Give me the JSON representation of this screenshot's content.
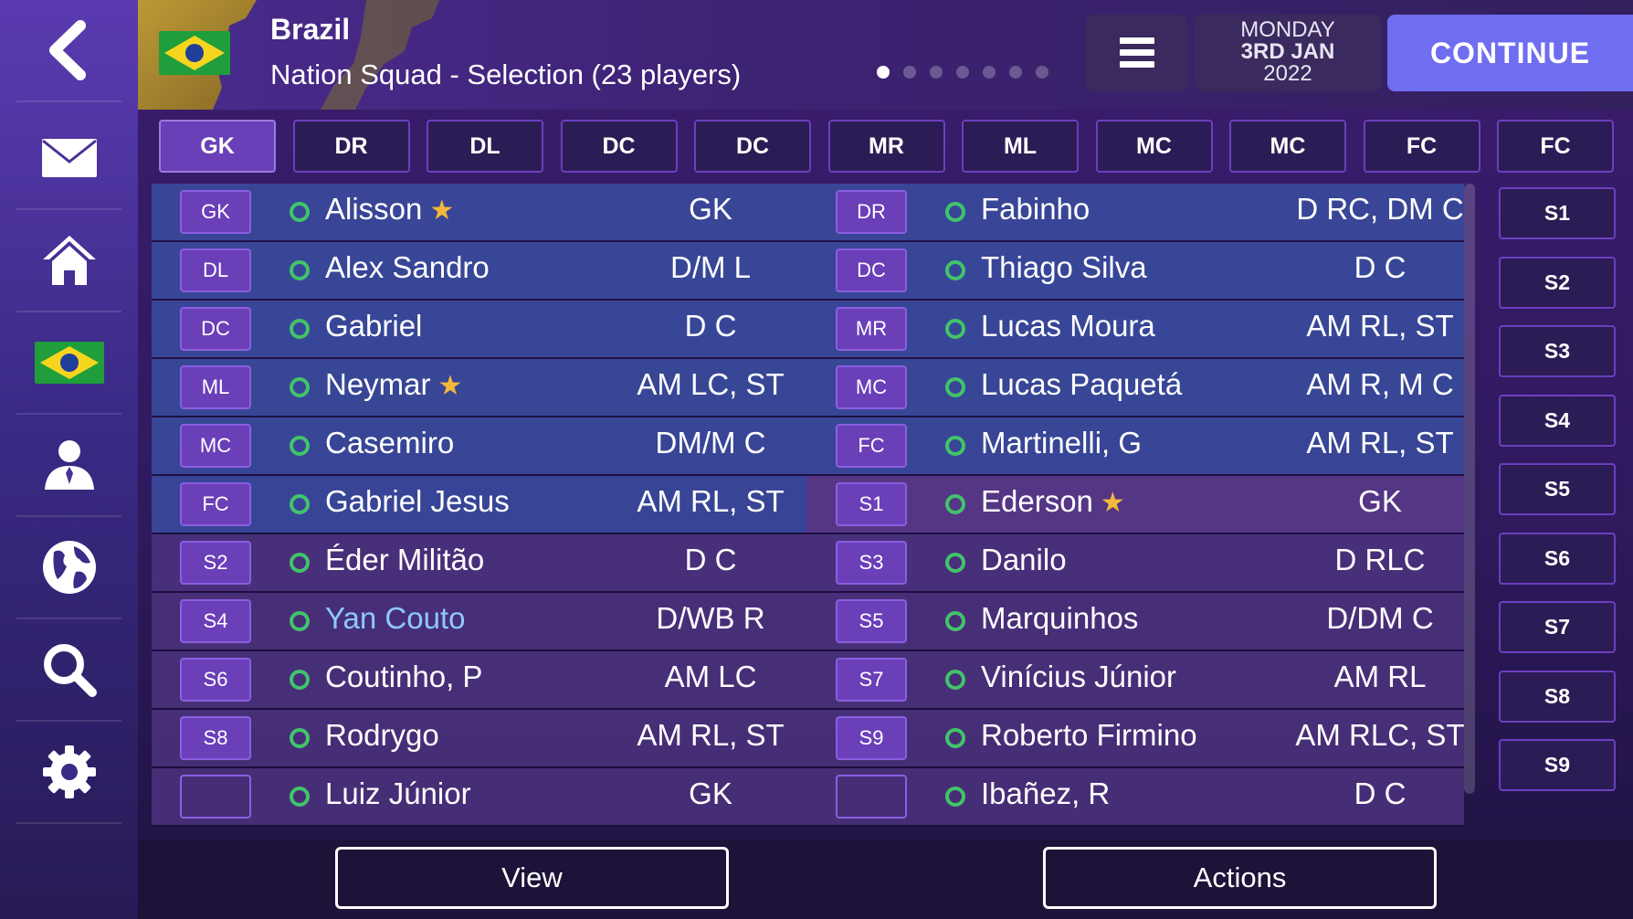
{
  "sidebar": {
    "items": [
      {
        "icon": "back-arrow-icon"
      },
      {
        "icon": "envelope-icon"
      },
      {
        "icon": "home-icon"
      },
      {
        "icon": "brazil-flag-icon"
      },
      {
        "icon": "manager-person-icon"
      },
      {
        "icon": "globe-icon"
      },
      {
        "icon": "search-icon"
      },
      {
        "icon": "gear-icon"
      }
    ]
  },
  "header": {
    "nation": "Brazil",
    "subtitle": "Nation Squad - Selection (23 players)",
    "page_count": 7,
    "current_page": 1,
    "date_day": "MONDAY",
    "date_date": "3RD JAN",
    "date_year": "2022",
    "continue_label": "CONTINUE"
  },
  "position_tabs": [
    "GK",
    "DR",
    "DL",
    "DC",
    "DC",
    "MR",
    "ML",
    "MC",
    "MC",
    "FC",
    "FC"
  ],
  "active_tab": 0,
  "players": [
    {
      "left": {
        "slot": "GK",
        "name": "Alisson",
        "star": true,
        "pos": "GK"
      },
      "right": {
        "slot": "DR",
        "name": "Fabinho",
        "star": false,
        "pos": "D RC, DM C"
      }
    },
    {
      "left": {
        "slot": "DL",
        "name": "Alex Sandro",
        "star": false,
        "pos": "D/M L"
      },
      "right": {
        "slot": "DC",
        "name": "Thiago Silva",
        "star": false,
        "pos": "D C"
      }
    },
    {
      "left": {
        "slot": "DC",
        "name": "Gabriel",
        "star": false,
        "pos": "D C"
      },
      "right": {
        "slot": "MR",
        "name": "Lucas Moura",
        "star": false,
        "pos": "AM RL, ST"
      }
    },
    {
      "left": {
        "slot": "ML",
        "name": "Neymar",
        "star": true,
        "pos": "AM LC, ST"
      },
      "right": {
        "slot": "MC",
        "name": "Lucas Paquetá",
        "star": false,
        "pos": "AM R, M C"
      }
    },
    {
      "left": {
        "slot": "MC",
        "name": "Casemiro",
        "star": false,
        "pos": "DM/M C"
      },
      "right": {
        "slot": "FC",
        "name": "Martinelli, G",
        "star": false,
        "pos": "AM RL, ST"
      }
    },
    {
      "left": {
        "slot": "FC",
        "name": "Gabriel Jesus",
        "star": false,
        "pos": "AM RL, ST"
      },
      "right": {
        "slot": "S1",
        "name": "Ederson",
        "star": true,
        "pos": "GK"
      }
    },
    {
      "left": {
        "slot": "S2",
        "name": "Éder Militão",
        "star": false,
        "pos": "D C"
      },
      "right": {
        "slot": "S3",
        "name": "Danilo",
        "star": false,
        "pos": "D RLC"
      }
    },
    {
      "left": {
        "slot": "S4",
        "name": "Yan Couto",
        "star": false,
        "pos": "D/WB R",
        "link": true
      },
      "right": {
        "slot": "S5",
        "name": "Marquinhos",
        "star": false,
        "pos": "D/DM C"
      }
    },
    {
      "left": {
        "slot": "S6",
        "name": "Coutinho, P",
        "star": false,
        "pos": "AM LC"
      },
      "right": {
        "slot": "S7",
        "name": "Vinícius Júnior",
        "star": false,
        "pos": "AM RL"
      }
    },
    {
      "left": {
        "slot": "S8",
        "name": "Rodrygo",
        "star": false,
        "pos": "AM RL, ST"
      },
      "right": {
        "slot": "S9",
        "name": "Roberto Firmino",
        "star": false,
        "pos": "AM RLC, ST"
      }
    },
    {
      "left": {
        "slot": "",
        "name": "Luiz Júnior",
        "star": false,
        "pos": "GK"
      },
      "right": {
        "slot": "",
        "name": "Ibañez, R",
        "star": false,
        "pos": "D C"
      }
    }
  ],
  "subs": [
    "S1",
    "S2",
    "S3",
    "S4",
    "S5",
    "S6",
    "S7",
    "S8",
    "S9"
  ],
  "bottom": {
    "view_label": "View",
    "actions_label": "Actions"
  },
  "colors": {
    "accent": "#6f6df0",
    "status_ok": "#41c46a",
    "star": "#f4b93a",
    "link": "#8ec8ff"
  }
}
